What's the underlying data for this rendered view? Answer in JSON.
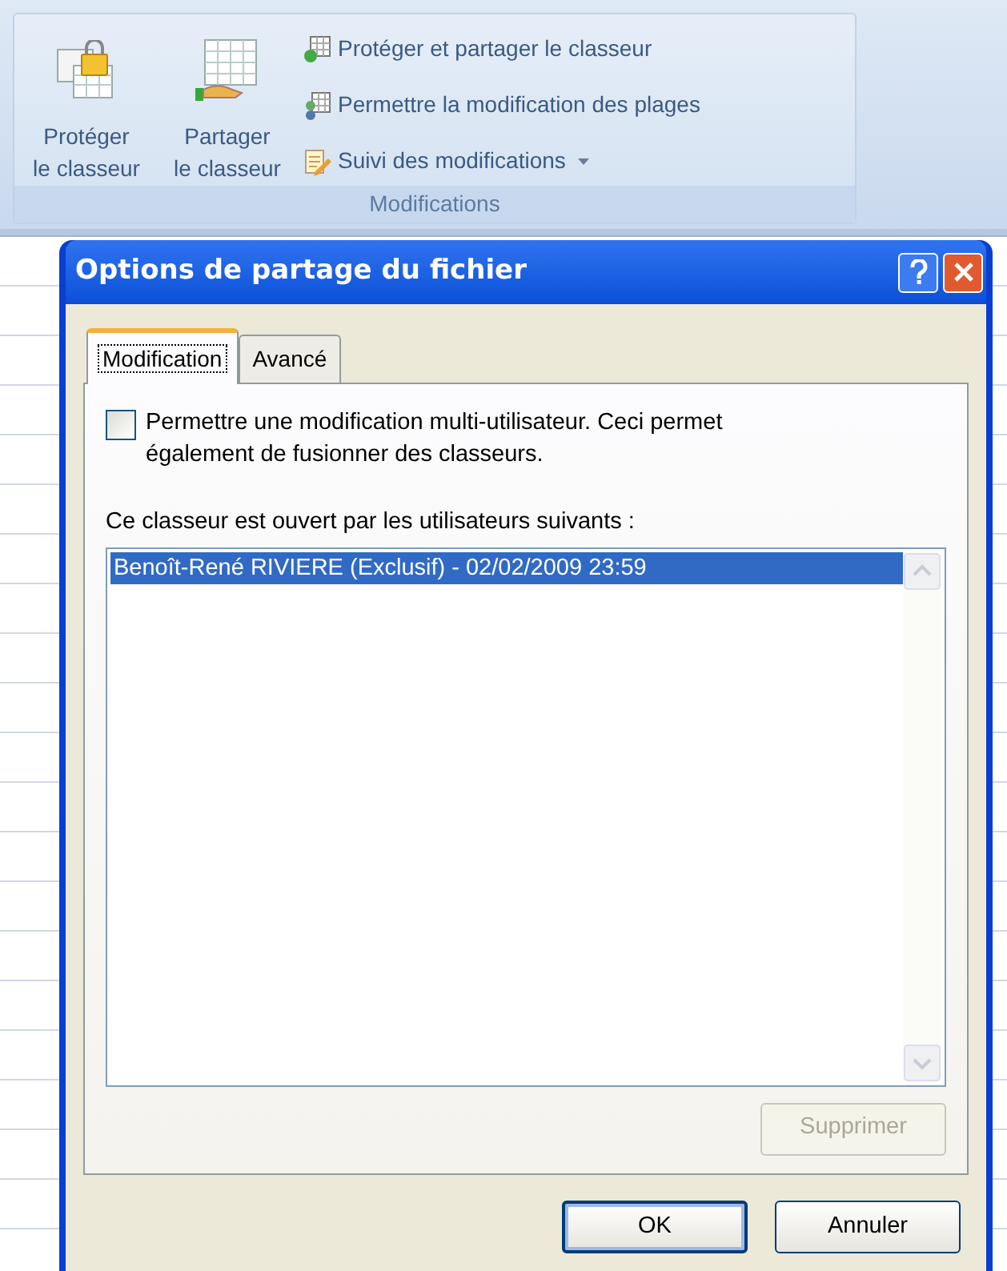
{
  "ribbon": {
    "large_buttons": [
      {
        "lines": [
          "Protéger",
          "le classeur"
        ],
        "kind": "lock"
      },
      {
        "lines": [
          "Partager",
          "le classeur"
        ],
        "kind": "share"
      }
    ],
    "small_buttons": [
      {
        "label": "Protéger et partager le classeur",
        "kind": "protect-share",
        "dropdown": false
      },
      {
        "label": "Permettre la modification des plages",
        "kind": "ranges",
        "dropdown": false
      },
      {
        "label": "Suivi des modifications",
        "kind": "track",
        "dropdown": true
      }
    ],
    "group_label": "Modifications"
  },
  "dialog": {
    "title": "Options de partage du fichier",
    "tabs": [
      {
        "label": "Modification",
        "selected": true
      },
      {
        "label": "Avancé",
        "selected": false
      }
    ],
    "checkbox": {
      "label": "Permettre une modification multi-utilisateur. Ceci permet également de fusionner des classeurs.",
      "checked": false
    },
    "list_label": "Ce classeur est ouvert par les utilisateurs suivants :",
    "users": [
      {
        "text": "Benoît-René RIVIERE (Exclusif) - 02/02/2009 23:59",
        "selected": true
      }
    ],
    "remove_button": {
      "label": "Supprimer",
      "disabled": true
    },
    "buttons": [
      {
        "label": "OK",
        "default": true
      },
      {
        "label": "Annuler",
        "default": false
      }
    ]
  }
}
